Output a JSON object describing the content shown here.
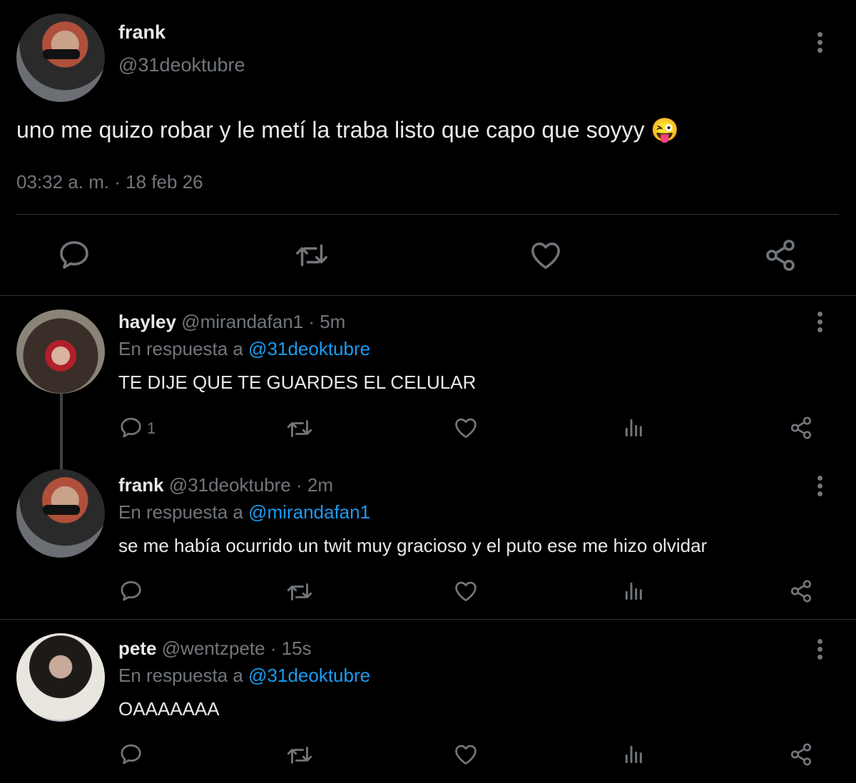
{
  "main_tweet": {
    "display_name": "frank",
    "handle": "@31deoktubre",
    "text": "uno me quizo robar y le metí la traba listo que capo que soyyy",
    "emoji": "😜",
    "timestamp": "03:32 a. m. · 18 feb 26"
  },
  "replies": [
    {
      "display_name": "hayley",
      "handle_time": "@mirandafan1 · 5m",
      "reply_prefix": "En respuesta a",
      "reply_to": "@31deoktubre",
      "text": "TE DIJE QUE TE GUARDES EL CELULAR",
      "reply_count": "1"
    },
    {
      "display_name": "frank",
      "handle_time": "@31deoktubre · 2m",
      "reply_prefix": "En respuesta a",
      "reply_to": "@mirandafan1",
      "text": "se me había ocurrido un twit muy gracioso y el puto ese me hizo olvidar",
      "reply_count": ""
    },
    {
      "display_name": "pete",
      "handle_time": "@wentzpete · 15s",
      "reply_prefix": "En respuesta a",
      "reply_to": "@31deoktubre",
      "text": "OAAAAAAA",
      "reply_count": ""
    }
  ],
  "icons": [
    "reply-icon",
    "retweet-icon",
    "like-icon",
    "share-icon",
    "views-icon",
    "more-icon"
  ],
  "colors": {
    "background": "#000000",
    "text": "#e7e9ea",
    "muted": "#71767b",
    "link": "#1d9bf0",
    "divider": "#2f3336"
  }
}
